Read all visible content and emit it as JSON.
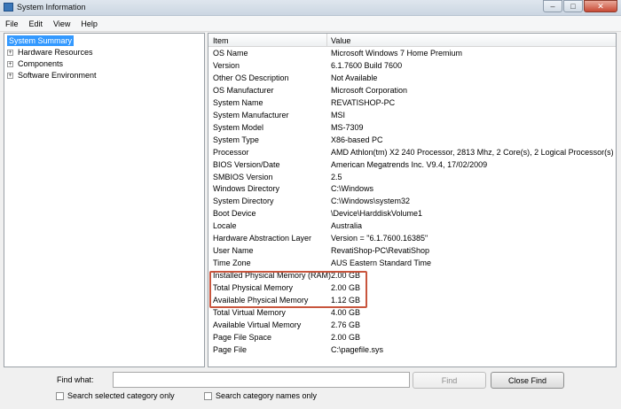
{
  "window": {
    "title": "System Information",
    "minimize": "–",
    "maximize": "□",
    "close": "✕"
  },
  "menu": [
    "File",
    "Edit",
    "View",
    "Help"
  ],
  "tree": [
    {
      "label": "System Summary",
      "selected": true,
      "expander": ""
    },
    {
      "label": "Hardware Resources",
      "selected": false,
      "expander": "+"
    },
    {
      "label": "Components",
      "selected": false,
      "expander": "+"
    },
    {
      "label": "Software Environment",
      "selected": false,
      "expander": "+"
    }
  ],
  "table": {
    "headers": {
      "item": "Item",
      "value": "Value"
    },
    "rows": [
      {
        "item": "OS Name",
        "value": "Microsoft Windows 7 Home Premium"
      },
      {
        "item": "Version",
        "value": "6.1.7600 Build 7600"
      },
      {
        "item": "Other OS Description",
        "value": "Not Available"
      },
      {
        "item": "OS Manufacturer",
        "value": "Microsoft Corporation"
      },
      {
        "item": "System Name",
        "value": "REVATISHOP-PC"
      },
      {
        "item": "System Manufacturer",
        "value": "MSI"
      },
      {
        "item": "System Model",
        "value": "MS-7309"
      },
      {
        "item": "System Type",
        "value": "X86-based PC"
      },
      {
        "item": "Processor",
        "value": "AMD Athlon(tm) X2 240 Processor, 2813 Mhz, 2 Core(s), 2 Logical Processor(s)"
      },
      {
        "item": "BIOS Version/Date",
        "value": "American Megatrends Inc. V9.4, 17/02/2009"
      },
      {
        "item": "SMBIOS Version",
        "value": "2.5"
      },
      {
        "item": "Windows Directory",
        "value": "C:\\Windows"
      },
      {
        "item": "System Directory",
        "value": "C:\\Windows\\system32"
      },
      {
        "item": "Boot Device",
        "value": "\\Device\\HarddiskVolume1"
      },
      {
        "item": "Locale",
        "value": "Australia"
      },
      {
        "item": "Hardware Abstraction Layer",
        "value": "Version = \"6.1.7600.16385\""
      },
      {
        "item": "User Name",
        "value": "RevatiShop-PC\\RevatiShop"
      },
      {
        "item": "Time Zone",
        "value": "AUS Eastern Standard Time"
      },
      {
        "item": "Installed Physical Memory (RAM)",
        "value": "2.00 GB"
      },
      {
        "item": "Total Physical Memory",
        "value": "2.00 GB"
      },
      {
        "item": "Available Physical Memory",
        "value": "1.12 GB"
      },
      {
        "item": "Total Virtual Memory",
        "value": "4.00 GB"
      },
      {
        "item": "Available Virtual Memory",
        "value": "2.76 GB"
      },
      {
        "item": "Page File Space",
        "value": "2.00 GB"
      },
      {
        "item": "Page File",
        "value": "C:\\pagefile.sys"
      }
    ]
  },
  "find": {
    "label": "Find what:",
    "value": "",
    "find_button": "Find",
    "close_button": "Close Find",
    "search_selected": "Search selected category only",
    "search_names": "Search category names only"
  },
  "colors": {
    "selection": "#3399ff",
    "highlight_box": "#c8553d"
  }
}
